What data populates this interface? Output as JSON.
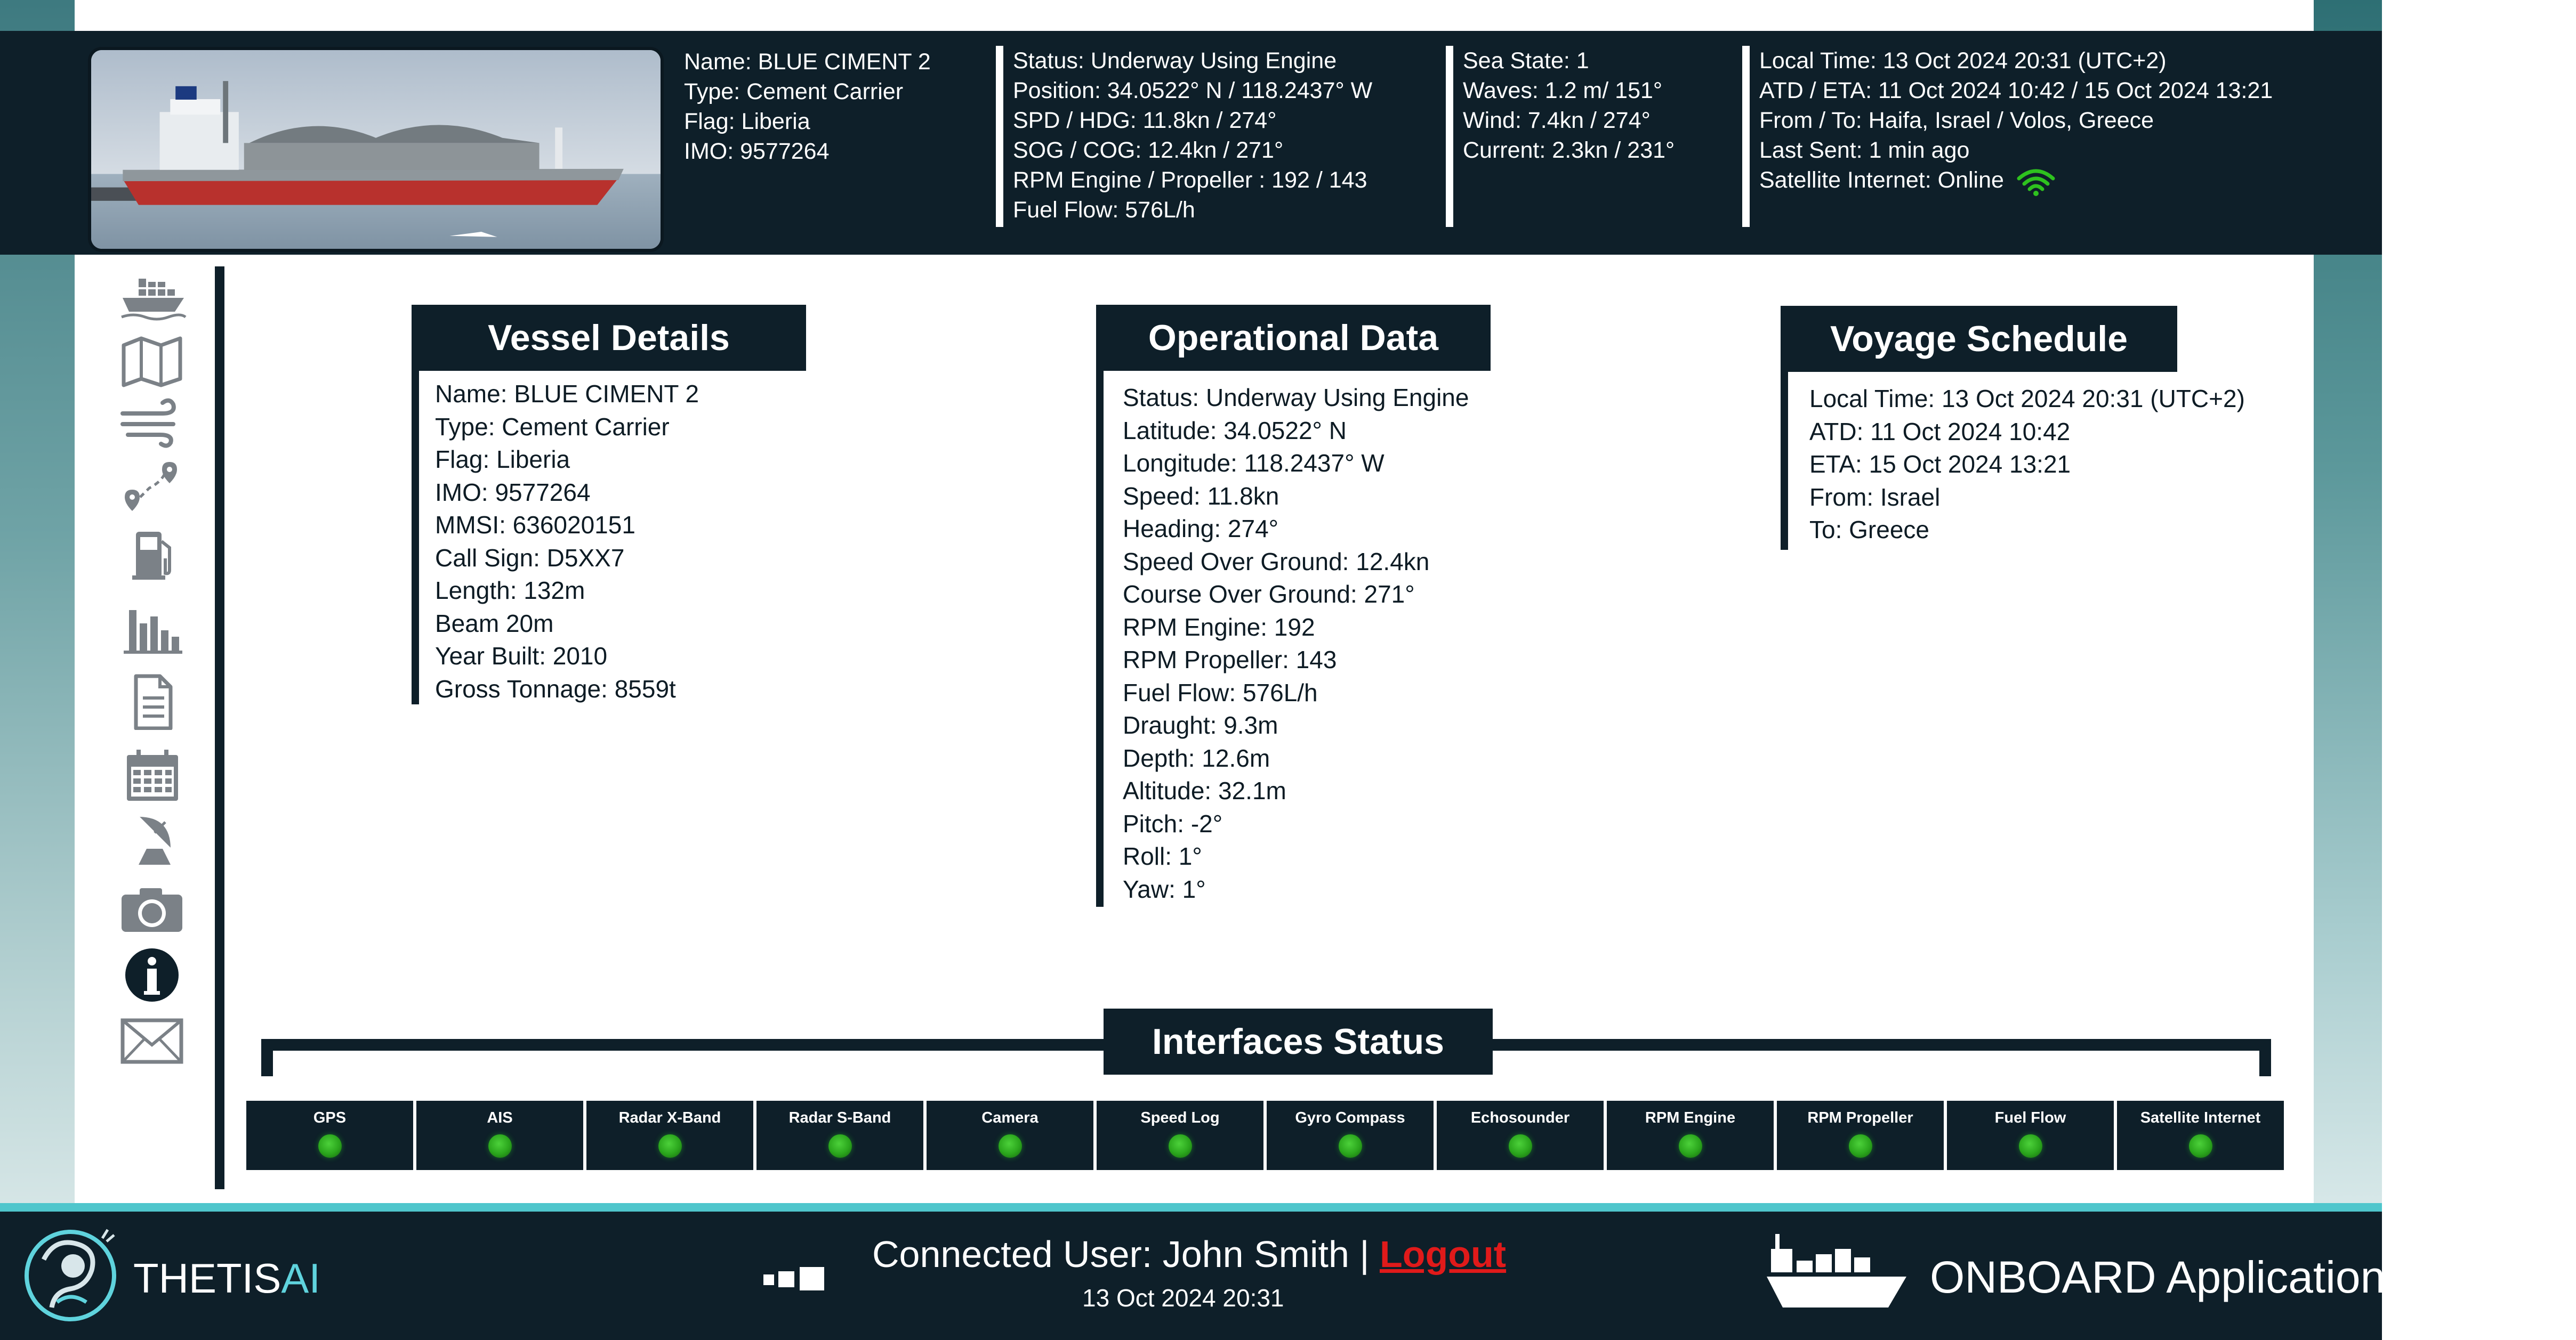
{
  "header": {
    "vessel": {
      "name": "Name: BLUE CIMENT 2",
      "type": "Type: Cement Carrier",
      "flag": "Flag: Liberia",
      "imo": "IMO: 9577264"
    },
    "nav": {
      "status": "Status: Underway Using Engine",
      "position": "Position: 34.0522° N / 118.2437° W",
      "spd_hdg": "SPD / HDG: 11.8kn / 274°",
      "sog_cog": "SOG / COG: 12.4kn / 271°",
      "rpm": "RPM Engine / Propeller : 192 / 143",
      "fuel": "Fuel Flow: 576L/h"
    },
    "sea": {
      "state": "Sea State: 1",
      "waves": "Waves: 1.2 m/ 151°",
      "wind": "Wind: 7.4kn / 274°",
      "current": "Current: 2.3kn / 231°"
    },
    "voyage": {
      "local_time": "Local Time: 13 Oct 2024 20:31 (UTC+2)",
      "atd_eta": "ATD / ETA: 11 Oct 2024 10:42  / 15 Oct 2024 13:21",
      "from_to": "From / To: Haifa, Israel / Volos, Greece",
      "last_sent": "Last Sent: 1 min ago",
      "satellite": "Satellite Internet: Online"
    }
  },
  "sidebar": {
    "items": [
      {
        "icon": "ship-icon"
      },
      {
        "icon": "map-icon"
      },
      {
        "icon": "wind-icon"
      },
      {
        "icon": "route-icon"
      },
      {
        "icon": "fuel-pump-icon"
      },
      {
        "icon": "bar-chart-icon"
      },
      {
        "icon": "document-icon"
      },
      {
        "icon": "calendar-icon"
      },
      {
        "icon": "satellite-dish-icon"
      },
      {
        "icon": "camera-icon"
      },
      {
        "icon": "info-icon"
      },
      {
        "icon": "mail-icon"
      }
    ]
  },
  "vessel_details": {
    "title": "Vessel Details",
    "lines": [
      "Name: BLUE CIMENT 2",
      "Type: Cement Carrier",
      "Flag: Liberia",
      "IMO: 9577264",
      "MMSI: 636020151",
      "Call Sign: D5XX7",
      "Length: 132m",
      "Beam 20m",
      "Year Built: 2010",
      "Gross Tonnage: 8559t"
    ]
  },
  "operational_data": {
    "title": "Operational Data",
    "lines": [
      "Status: Underway Using Engine",
      "Latitude: 34.0522° N",
      "Longitude: 118.2437° W",
      "Speed: 11.8kn",
      "Heading: 274°",
      "Speed Over Ground: 12.4kn",
      "Course Over Ground: 271°",
      "RPM Engine: 192",
      "RPM Propeller: 143",
      "Fuel Flow: 576L/h",
      "Draught: 9.3m",
      "Depth: 12.6m",
      "Altitude: 32.1m",
      "Pitch: -2°",
      "Roll: 1°",
      "Yaw: 1°"
    ]
  },
  "voyage_schedule": {
    "title": "Voyage Schedule",
    "lines": [
      "Local Time: 13 Oct 2024 20:31 (UTC+2)",
      "ATD: 11 Oct 2024 10:42",
      "ETA: 15 Oct 2024 13:21",
      "From: Israel",
      "To: Greece"
    ]
  },
  "interfaces": {
    "title": "Interfaces Status",
    "items": [
      {
        "label": "GPS",
        "status": "online"
      },
      {
        "label": "AIS",
        "status": "online"
      },
      {
        "label": "Radar X-Band",
        "status": "online"
      },
      {
        "label": "Radar S-Band",
        "status": "online"
      },
      {
        "label": "Camera",
        "status": "online"
      },
      {
        "label": "Speed Log",
        "status": "online"
      },
      {
        "label": "Gyro Compass",
        "status": "online"
      },
      {
        "label": "Echosounder",
        "status": "online"
      },
      {
        "label": "RPM Engine",
        "status": "online"
      },
      {
        "label": "RPM Propeller",
        "status": "online"
      },
      {
        "label": "Fuel Flow",
        "status": "online"
      },
      {
        "label": "Satellite Internet",
        "status": "online"
      }
    ],
    "online_color": "#2aa51c"
  },
  "footer": {
    "brand_main": "THETIS",
    "brand_ai": "AI",
    "user_prefix": "Connected User: John Smith | ",
    "logout": "Logout",
    "date": "13 Oct 2024 20:31",
    "app_name": "ONBOARD Application"
  },
  "colors": {
    "dark": "#0e1f29",
    "accent": "#4fc6cc",
    "logout": "#e01a1a"
  }
}
